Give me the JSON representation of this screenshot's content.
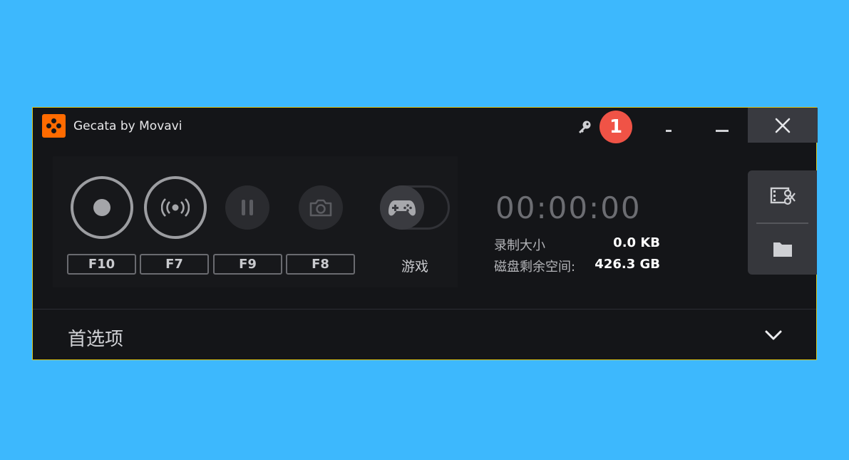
{
  "app": {
    "title": "Gecata by Movavi",
    "brand_color": "#ff6b00"
  },
  "titlebar": {
    "badge_number": "1"
  },
  "controls": {
    "hotkeys": [
      "F10",
      "F7",
      "F9",
      "F8"
    ],
    "game_mode_label": "游戏"
  },
  "status": {
    "timer": "00:00:00",
    "recording_size_label": "录制大小",
    "recording_size_value": "0.0 KB",
    "disk_space_label": "磁盘剩余空间:",
    "disk_space_value": "426.3 GB"
  },
  "footer": {
    "preferences_label": "首选项"
  },
  "icons": [
    "app-logo-icon",
    "key-icon",
    "record-icon",
    "stream-icon",
    "pause-icon",
    "camera-icon",
    "gamepad-icon",
    "video-edit-icon",
    "folder-icon",
    "chevron-down-icon",
    "close-icon"
  ]
}
